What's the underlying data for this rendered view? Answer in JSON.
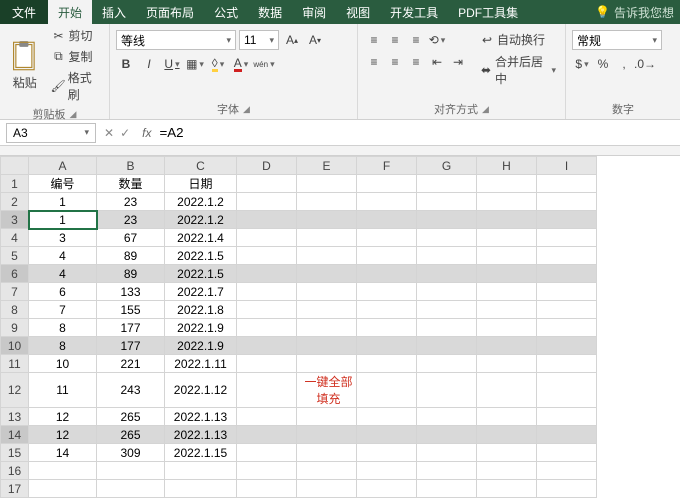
{
  "tabs": {
    "file": "文件",
    "home": "开始",
    "insert": "插入",
    "layout": "页面布局",
    "formulas": "公式",
    "data": "数据",
    "review": "审阅",
    "view": "视图",
    "dev": "开发工具",
    "pdf": "PDF工具集",
    "tellme": "告诉我您想"
  },
  "ribbon": {
    "clipboard": {
      "label": "剪贴板",
      "cut": "剪切",
      "copy": "复制",
      "format_painter": "格式刷",
      "paste": "粘贴"
    },
    "font": {
      "label": "字体",
      "name": "等线",
      "size": "11"
    },
    "align": {
      "label": "对齐方式",
      "wrap": "自动换行",
      "merge": "合并后居中"
    },
    "number": {
      "label": "数字",
      "format": "常规"
    }
  },
  "namebox": "A3",
  "formula": "=A2",
  "columns": [
    "A",
    "B",
    "C",
    "D",
    "E",
    "F",
    "G",
    "H",
    "I"
  ],
  "headers": {
    "a": "编号",
    "b": "数量",
    "c": "日期"
  },
  "rows": [
    {
      "n": 1,
      "a": "编号",
      "b": "数量",
      "c": "日期",
      "header": true
    },
    {
      "n": 2,
      "a": "1",
      "b": "23",
      "c": "2022.1.2"
    },
    {
      "n": 3,
      "a": "1",
      "b": "23",
      "c": "2022.1.2",
      "hl": true,
      "active": true
    },
    {
      "n": 4,
      "a": "3",
      "b": "67",
      "c": "2022.1.4"
    },
    {
      "n": 5,
      "a": "4",
      "b": "89",
      "c": "2022.1.5"
    },
    {
      "n": 6,
      "a": "4",
      "b": "89",
      "c": "2022.1.5",
      "hl": true
    },
    {
      "n": 7,
      "a": "6",
      "b": "133",
      "c": "2022.1.7"
    },
    {
      "n": 8,
      "a": "7",
      "b": "155",
      "c": "2022.1.8"
    },
    {
      "n": 9,
      "a": "8",
      "b": "177",
      "c": "2022.1.9"
    },
    {
      "n": 10,
      "a": "8",
      "b": "177",
      "c": "2022.1.9",
      "hl": true
    },
    {
      "n": 11,
      "a": "10",
      "b": "221",
      "c": "2022.1.11"
    },
    {
      "n": 12,
      "a": "11",
      "b": "243",
      "c": "2022.1.12",
      "note": "一键全部填充"
    },
    {
      "n": 13,
      "a": "12",
      "b": "265",
      "c": "2022.1.13"
    },
    {
      "n": 14,
      "a": "12",
      "b": "265",
      "c": "2022.1.13",
      "hl": true
    },
    {
      "n": 15,
      "a": "14",
      "b": "309",
      "c": "2022.1.15"
    },
    {
      "n": 16,
      "a": "",
      "b": "",
      "c": ""
    },
    {
      "n": 17,
      "a": "",
      "b": "",
      "c": ""
    }
  ],
  "chart_data": {
    "type": "table",
    "title": "",
    "columns": [
      "编号",
      "数量",
      "日期"
    ],
    "records": [
      {
        "编号": 1,
        "数量": 23,
        "日期": "2022.1.2"
      },
      {
        "编号": 1,
        "数量": 23,
        "日期": "2022.1.2"
      },
      {
        "编号": 3,
        "数量": 67,
        "日期": "2022.1.4"
      },
      {
        "编号": 4,
        "数量": 89,
        "日期": "2022.1.5"
      },
      {
        "编号": 4,
        "数量": 89,
        "日期": "2022.1.5"
      },
      {
        "编号": 6,
        "数量": 133,
        "日期": "2022.1.7"
      },
      {
        "编号": 7,
        "数量": 155,
        "日期": "2022.1.8"
      },
      {
        "编号": 8,
        "数量": 177,
        "日期": "2022.1.9"
      },
      {
        "编号": 8,
        "数量": 177,
        "日期": "2022.1.9"
      },
      {
        "编号": 10,
        "数量": 221,
        "日期": "2022.1.11"
      },
      {
        "编号": 11,
        "数量": 243,
        "日期": "2022.1.12"
      },
      {
        "编号": 12,
        "数量": 265,
        "日期": "2022.1.13"
      },
      {
        "编号": 12,
        "数量": 265,
        "日期": "2022.1.13"
      },
      {
        "编号": 14,
        "数量": 309,
        "日期": "2022.1.15"
      }
    ]
  }
}
